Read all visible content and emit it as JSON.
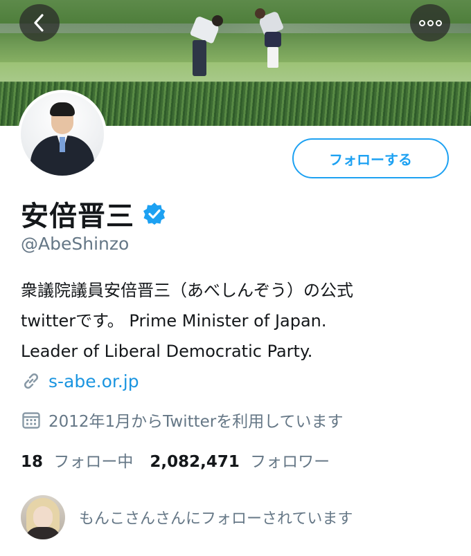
{
  "header": {
    "back_icon": "chevron-left-icon",
    "more_icon": "more-horizontal-icon"
  },
  "profile": {
    "display_name": "安倍晋三",
    "verified": true,
    "handle": "@AbeShinzo",
    "follow_button_label": "フォローする",
    "bio_lines": [
      "衆議院議員安倍晋三（あべしんぞう）の公式",
      "twitterです。 Prime Minister of Japan.",
      "Leader of Liberal Democratic Party."
    ],
    "website": "s-abe.or.jp",
    "joined": "2012年1月からTwitterを利用しています",
    "following_count": "18",
    "following_label": "フォロー中",
    "followers_count": "2,082,471",
    "followers_label": "フォロワー",
    "followed_by_text": "もんこさんさんにフォローされています"
  },
  "colors": {
    "accent": "#1da1f2",
    "link": "#1b95e0",
    "secondary_text": "#657786",
    "primary_text": "#14171a"
  }
}
